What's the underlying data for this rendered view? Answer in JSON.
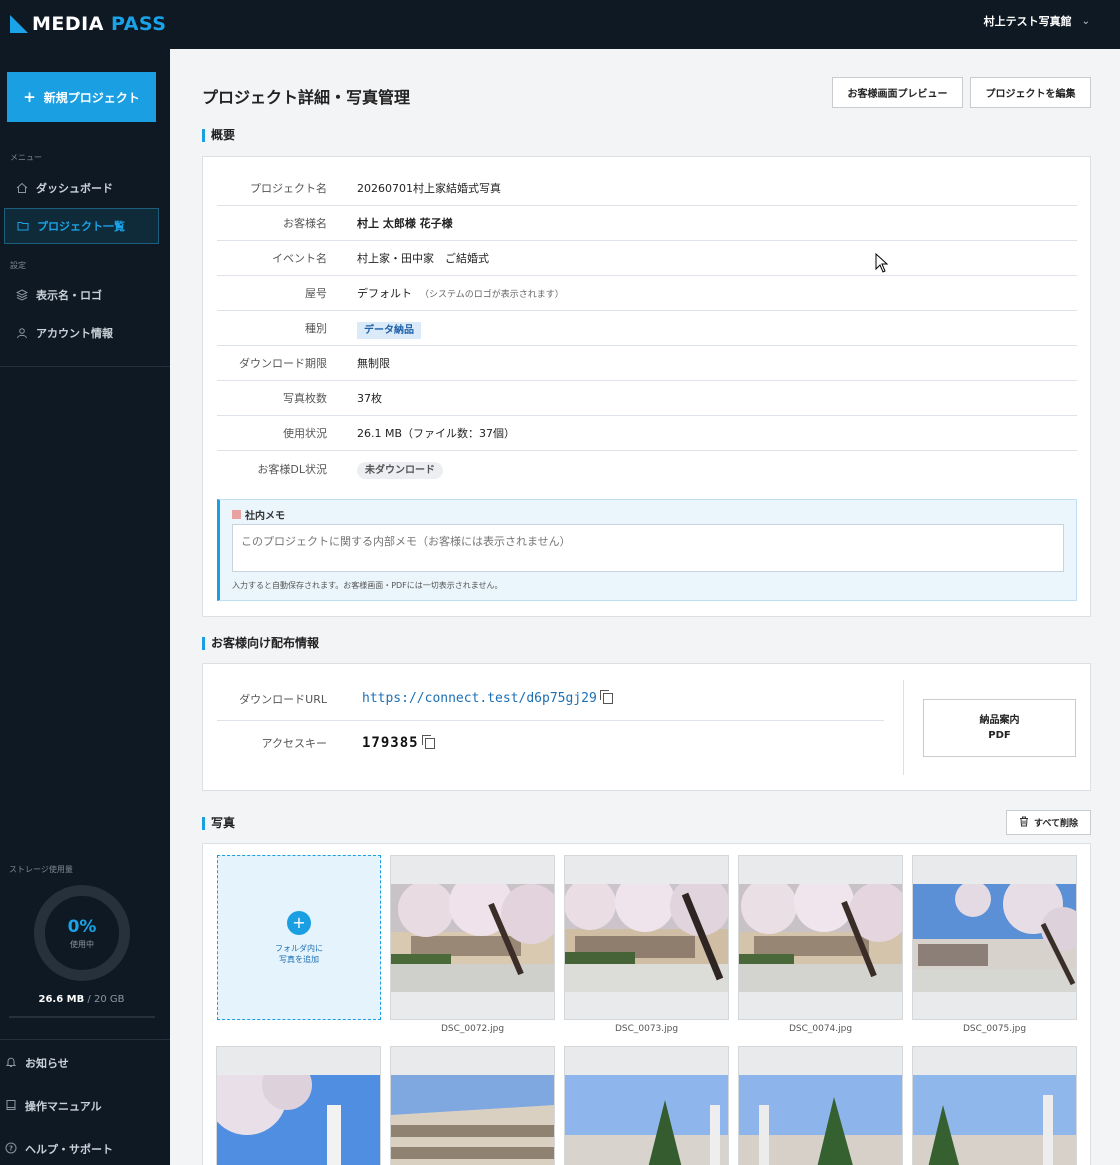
{
  "app": {
    "logo_main": "MEDIA ",
    "logo_accent": "PASS",
    "studio_name": "村上テスト写真館"
  },
  "sidebar": {
    "new_project": "新規プロジェクト",
    "menu_label": "メニュー",
    "settings_label": "設定",
    "items": [
      {
        "label": "ダッシュボード",
        "icon": "home-icon"
      },
      {
        "label": "プロジェクト一覧",
        "icon": "folder-icon",
        "active": true
      },
      {
        "label": "表示名・ロゴ",
        "icon": "layers-icon"
      },
      {
        "label": "アカウント情報",
        "icon": "user-icon"
      }
    ],
    "storage": {
      "label": "ストレージ使用量",
      "percent": "0%",
      "using": "使用中",
      "used": "26.6 MB",
      "total": " / 20 GB"
    },
    "footer": [
      {
        "label": "お知らせ",
        "icon": "bell-icon"
      },
      {
        "label": "操作マニュアル",
        "icon": "book-icon"
      },
      {
        "label": "ヘルプ・サポート",
        "icon": "help-icon"
      }
    ]
  },
  "header": {
    "title": "プロジェクト詳細・写真管理",
    "preview_button": "お客様画面プレビュー",
    "edit_button": "プロジェクトを編集"
  },
  "overview": {
    "heading": "概要",
    "rows": [
      {
        "label": "プロジェクト名",
        "value": "20260701村上家結婚式写真"
      },
      {
        "label": "お客様名",
        "value": "村上 太郎様 花子様"
      },
      {
        "label": "イベント名",
        "value": "村上家・田中家　ご結婚式"
      },
      {
        "label": "屋号",
        "value": "デフォルト",
        "note": "（システムのロゴが表示されます）"
      },
      {
        "label": "種別",
        "value": "データ納品"
      },
      {
        "label": "ダウンロード期限",
        "value": "無制限"
      },
      {
        "label": "写真枚数",
        "value": "37枚"
      },
      {
        "label": "使用状況",
        "value": "26.1 MB（ファイル数：37個）"
      },
      {
        "label": "お客様DL状況",
        "value": "未ダウンロード"
      }
    ],
    "memo": {
      "title": "社内メモ",
      "placeholder": "このプロジェクトに関する内部メモ（お客様には表示されません）",
      "help": "入力すると自動保存されます。お客様画面・PDFには一切表示されません。"
    }
  },
  "distribution": {
    "heading": "お客様向け配布情報",
    "url_label": "ダウンロードURL",
    "url": "https://connect.test/d6p75gj29",
    "key_label": "アクセスキー",
    "key": "179385",
    "pdf_line1": "納品案内",
    "pdf_line2": "PDF"
  },
  "photos": {
    "heading": "写真",
    "delete_all": "すべて削除",
    "add_line1": "フォルダ内に",
    "add_line2": "写真を追加",
    "files": [
      "DSC_0072.jpg",
      "DSC_0073.jpg",
      "DSC_0074.jpg",
      "DSC_0075.jpg"
    ]
  },
  "colors": {
    "accent": "#1a9fe3",
    "sidebar_bg": "#0f1923"
  }
}
